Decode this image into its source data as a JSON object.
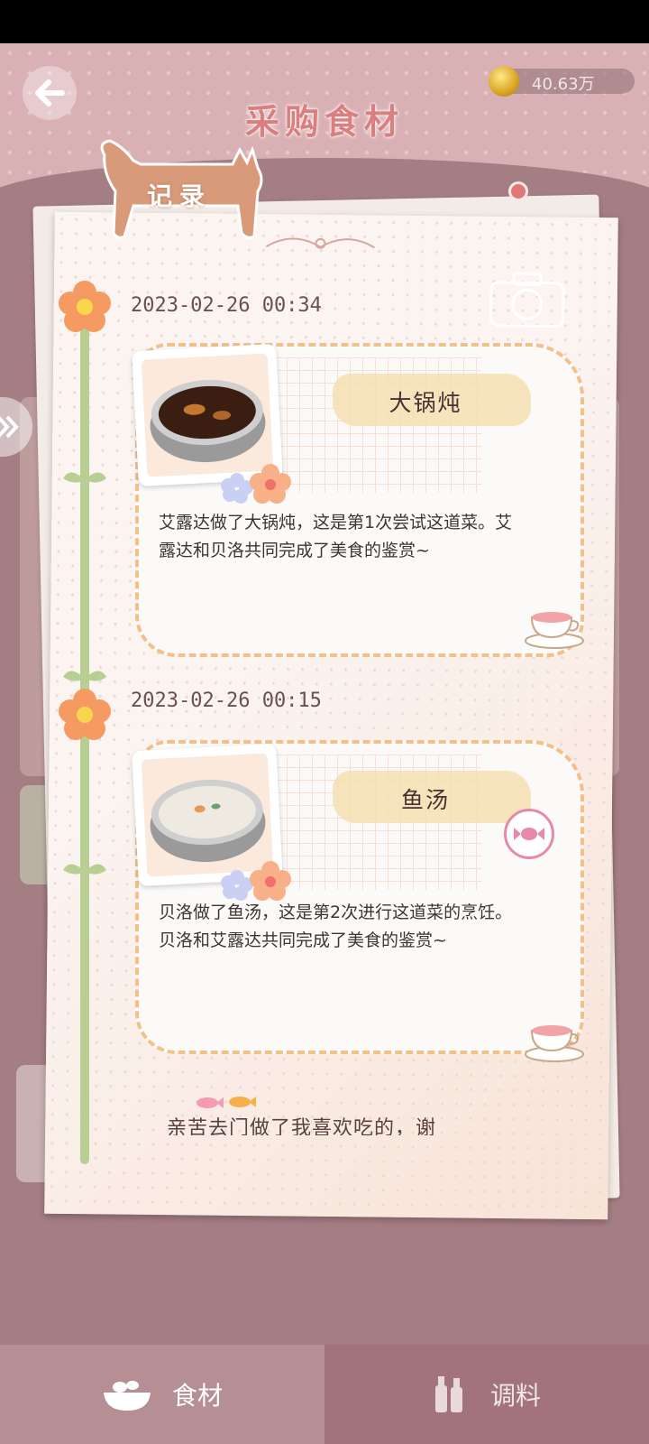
{
  "header": {
    "title": "采购食材",
    "coins": "40.63万"
  },
  "record_tag": "记录",
  "entries": [
    {
      "timestamp": "2023-02-26 00:34",
      "dish": "大锅炖",
      "description": "艾露达做了大锅炖，这是第1次尝试这道菜。艾露达和贝洛共同完成了美食的鉴赏~"
    },
    {
      "timestamp": "2023-02-26 00:15",
      "dish": "鱼汤",
      "description": "贝洛做了鱼汤，这是第2次进行这道菜的烹饪。贝洛和艾露达共同完成了美食的鉴赏~"
    }
  ],
  "bottom_note": "亲苦去门做了我喜欢吃的，谢",
  "tabs": [
    {
      "label": "食材",
      "icon": "bowl-icon"
    },
    {
      "label": "调料",
      "icon": "bottles-icon"
    }
  ],
  "colors": {
    "title": "#d97f7f",
    "accent": "#f3c08a",
    "stem": "#b8cf94"
  }
}
